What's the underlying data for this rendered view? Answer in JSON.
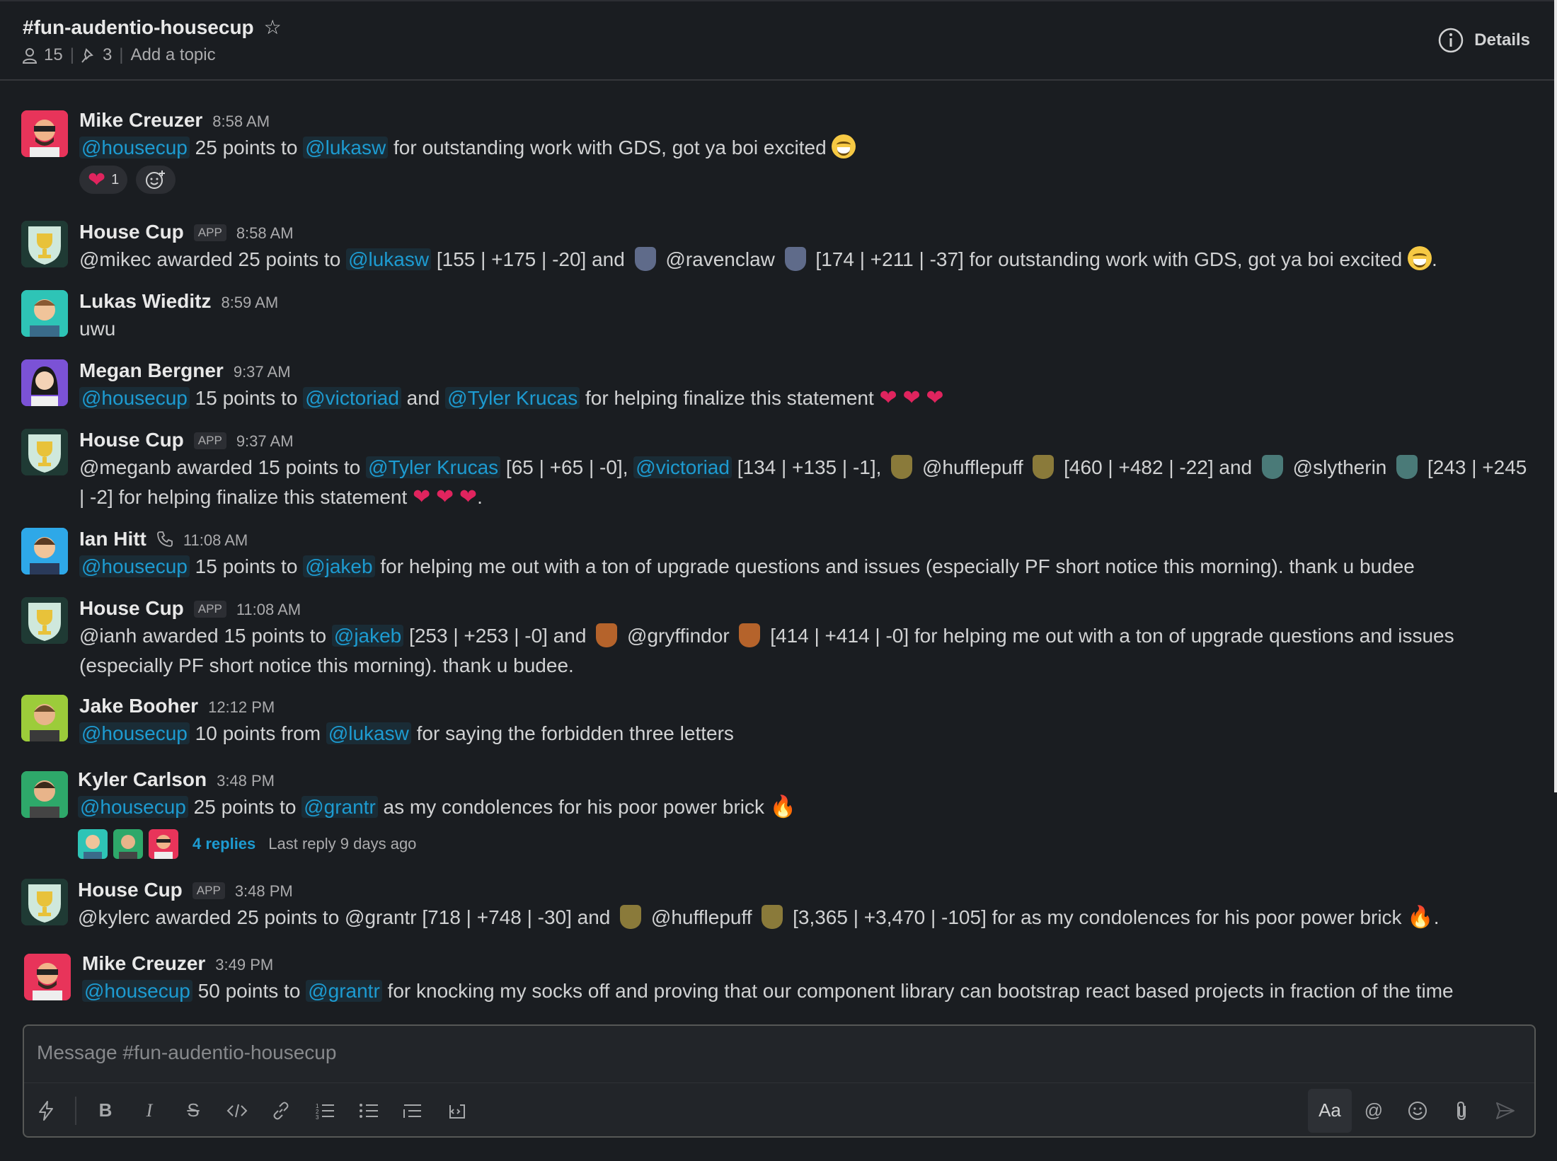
{
  "header": {
    "channel": "#fun-audentio-housecup",
    "members": "15",
    "pins": "3",
    "topic": "Add a topic",
    "details": "Details"
  },
  "messages": [
    {
      "author": "Mike Creuzer",
      "time": "8:58 AM",
      "parts": [
        {
          "m": "@housecup"
        },
        {
          "t": " 25 points to "
        },
        {
          "m": "@lukasw"
        },
        {
          "t": " for outstanding work with GDS, got ya boi excited "
        }
      ],
      "reaction_count": "1"
    },
    {
      "author": "House Cup",
      "badge": "APP",
      "time": "8:58 AM",
      "text1": "@mikec awarded 25 points  to ",
      "m1": "@lukasw",
      "text2": " [155 | +175 | -20] and ",
      "text3": " @ravenclaw ",
      "text4": " [174 | +211 | -37] for outstanding work with GDS, got ya boi excited ",
      "text5": "."
    },
    {
      "author": "Lukas Wieditz",
      "time": "8:59 AM",
      "text": "uwu"
    },
    {
      "author": "Megan Bergner",
      "time": "9:37 AM",
      "m1": "@housecup",
      "t1": " 15 points to ",
      "m2": "@victoriad",
      "t2": " and ",
      "m3": "@Tyler Krucas",
      "t3": " for helping finalize this statement "
    },
    {
      "author": "House Cup",
      "badge": "APP",
      "time": "9:37 AM",
      "t1": "@meganb awarded 15 points  to ",
      "m1": "@Tyler Krucas",
      "t2": " [65 | +65 | -0], ",
      "m2": "@victoriad",
      "t3": " [134 | +135 | -1], ",
      "t4": " @hufflepuff ",
      "t5": " [460 | +482 | -22] and ",
      "t6": " @slytherin ",
      "t7": " [243 | +245 | -2] for helping finalize this statement ",
      "t8": "."
    },
    {
      "author": "Ian Hitt",
      "time": "11:08 AM",
      "m1": "@housecup",
      "t1": " 15 points to ",
      "m2": "@jakeb",
      "t2": " for helping me out with a ton of upgrade questions and issues (especially PF short notice this morning). thank u budee"
    },
    {
      "author": "House Cup",
      "badge": "APP",
      "time": "11:08 AM",
      "t1": "@ianh awarded 15 points  to ",
      "m1": "@jakeb",
      "t2": " [253 | +253 | -0] and ",
      "t3": " @gryffindor ",
      "t4": " [414 | +414 | -0] for helping me out with a ton of upgrade questions and issues (especially PF short notice this morning). thank u budee."
    },
    {
      "author": "Jake Booher",
      "time": "12:12 PM",
      "m1": "@housecup",
      "t1": " 10 points from ",
      "m2": "@lukasw",
      "t2": " for saying the forbidden three letters"
    },
    {
      "author": "Kyler Carlson",
      "time": "3:48 PM",
      "m1": "@housecup",
      "t1": " 25 points to ",
      "m2": "@grantr",
      "t2": " as my condolences for his poor power brick ",
      "replies": "4 replies",
      "last_reply": "Last reply 9 days ago"
    },
    {
      "author": "House Cup",
      "badge": "APP",
      "time": "3:48 PM",
      "t1": "@kylerc awarded 25 points to @grantr [718 | +748 | -30] and ",
      "t2": " @hufflepuff ",
      "t3": " [3,365 | +3,470 | -105] for as my condolences for his poor power brick ",
      "t4": "."
    },
    {
      "author": "Mike Creuzer",
      "time": "3:49 PM",
      "m1": "@housecup",
      "t1": " 50 points to ",
      "m2": "@grantr",
      "t2": " for knocking my socks off and proving that our component library can bootstrap react based projects in fraction of the time"
    }
  ],
  "composer": {
    "placeholder": "Message #fun-audentio-housecup",
    "format_label": "Aa"
  },
  "colors": {
    "background": "#1a1d21",
    "mention": "#1d9bd1",
    "heart": "#e0245e"
  }
}
